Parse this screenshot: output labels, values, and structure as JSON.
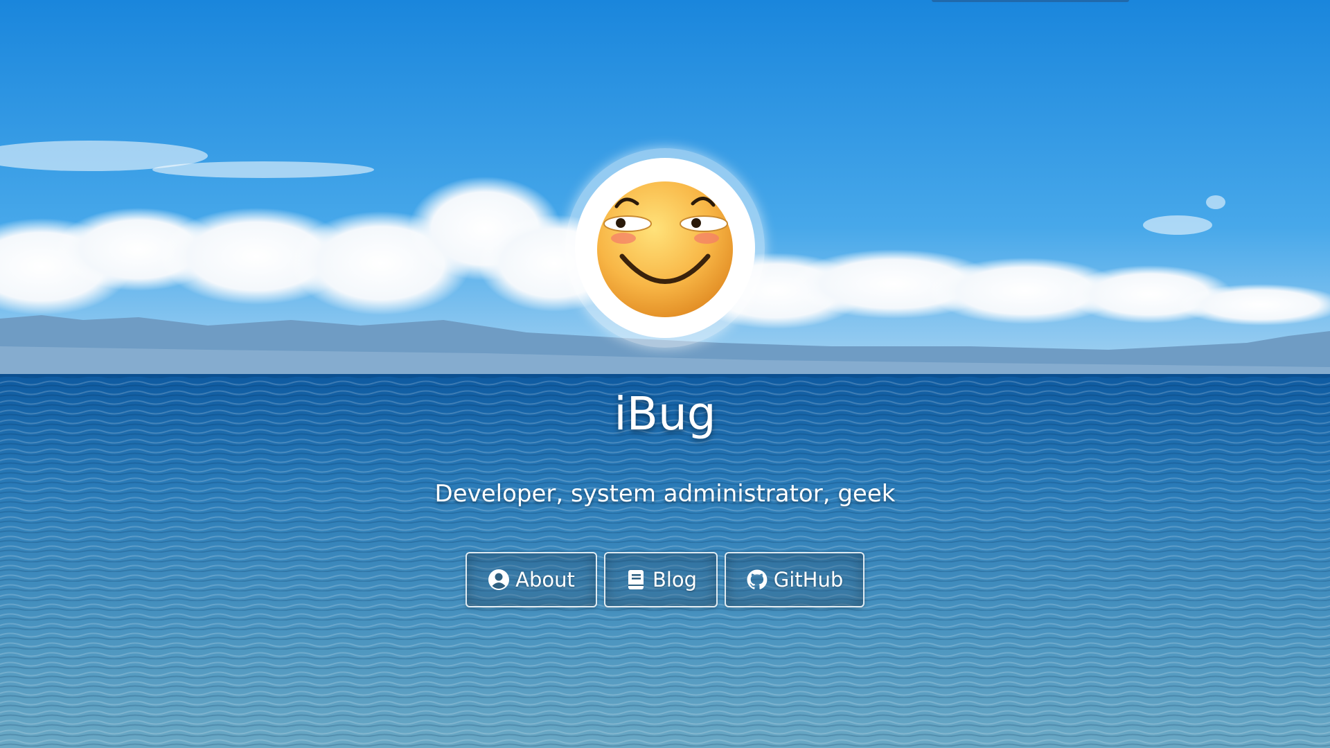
{
  "site": {
    "title": "iBug",
    "tagline": "Developer, system administrator, geek"
  },
  "avatar": {
    "icon": "grinning-smirk-emoji-icon"
  },
  "nav": {
    "items": [
      {
        "label": "About",
        "icon": "user-circle-icon"
      },
      {
        "label": "Blog",
        "icon": "book-icon"
      },
      {
        "label": "GitHub",
        "icon": "github-icon"
      }
    ]
  },
  "colors": {
    "sky": "#1f8fe0",
    "sea": "#1a6fae",
    "text": "#ffffff",
    "button_border": "#ffffff"
  }
}
